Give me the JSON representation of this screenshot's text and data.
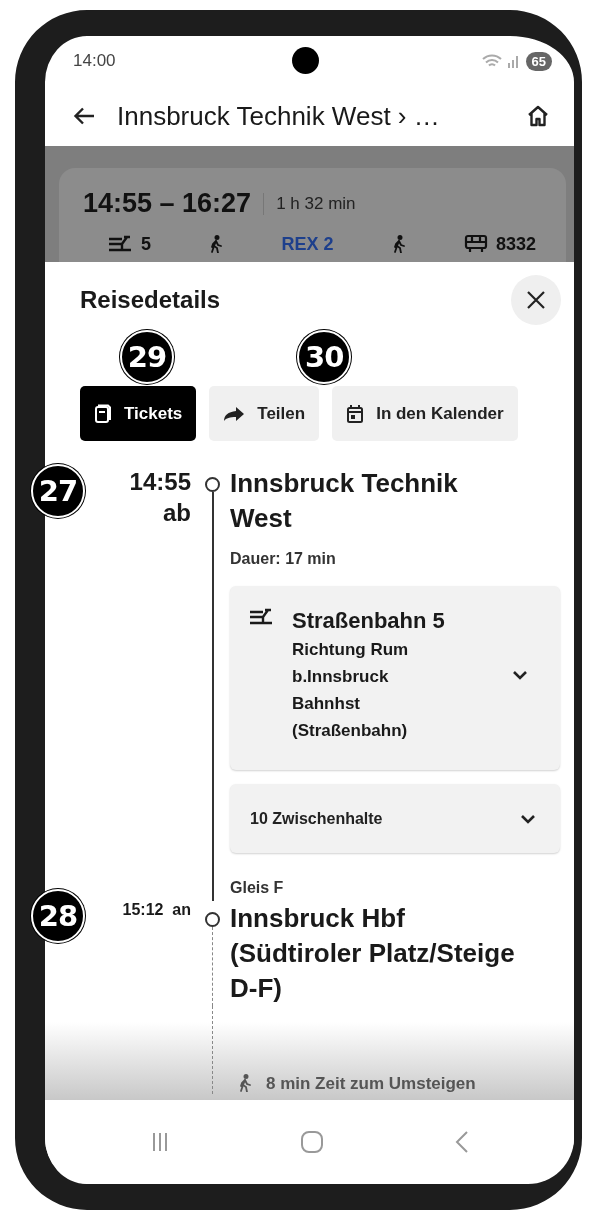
{
  "status_bar": {
    "time": "14:00",
    "battery": "65"
  },
  "app_bar": {
    "title": "Innsbruck Technik West › …"
  },
  "background_trip": {
    "times": "14:55 – 16:27",
    "duration": "1 h 32 min",
    "legs": [
      {
        "kind": "tram",
        "label": "5"
      },
      {
        "kind": "walk"
      },
      {
        "kind": "train",
        "label": "REX 2"
      },
      {
        "kind": "walk"
      },
      {
        "kind": "bus",
        "label": "8332"
      }
    ]
  },
  "sheet": {
    "title": "Reisedetails",
    "actions": [
      {
        "kind": "tickets",
        "label": "Tickets",
        "selected": true,
        "badge": "29"
      },
      {
        "kind": "share",
        "label": "Teilen",
        "selected": false
      },
      {
        "kind": "calendar",
        "label": "In den Kalender",
        "selected": false,
        "badge": "30"
      }
    ],
    "departure": {
      "time": "14:55",
      "event": "ab",
      "station": "Innsbruck Technik West",
      "duration": "Dauer: 17 min",
      "badge": "27"
    },
    "leg": {
      "line": "Straßenbahn 5",
      "direction": "Richtung Rum b.Innsbruck Bahnhst (Straßenbahn)",
      "expanded": false
    },
    "intermediate_stops": {
      "label": "10 Zwischenhalte",
      "expanded": false
    },
    "arrival": {
      "platform": "Gleis F",
      "time": "15:12",
      "event": "an",
      "station": "Innsbruck Hbf (Südtiroler Platz/Steige D-F)",
      "badge": "28"
    },
    "transfer": {
      "text": "8 min Zeit zum Umsteigen"
    }
  }
}
